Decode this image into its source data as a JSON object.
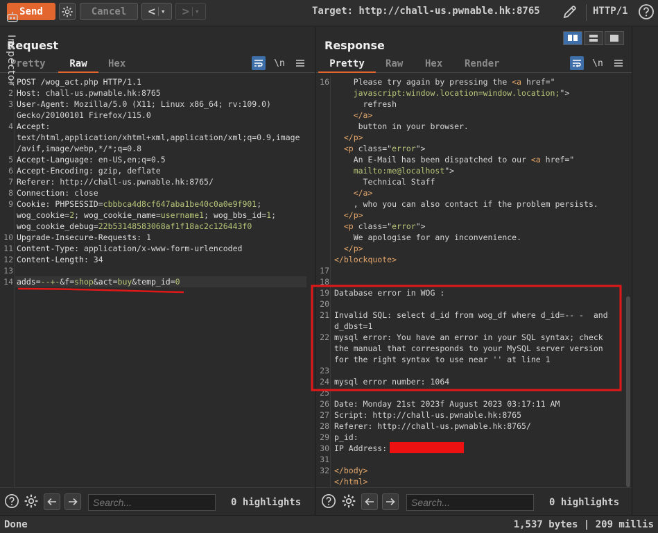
{
  "toolbar": {
    "send": "Send",
    "cancel": "Cancel",
    "target": "Target: http://chall-us.pwnable.hk:8765",
    "protocol": "HTTP/1",
    "back_arrow": "<",
    "fwd_arrow": ">",
    "dropdown": "▾"
  },
  "request": {
    "title": "Request",
    "tabs": [
      "Pretty",
      "Raw",
      "Hex"
    ],
    "active_tab": "Raw",
    "newline_toggle": "\\n",
    "lines": [
      {
        "n": "1",
        "parts": [
          [
            "k",
            "POST /wog_act.php HTTP/1.1"
          ]
        ]
      },
      {
        "n": "2",
        "parts": [
          [
            "k",
            "Host"
          ],
          [
            "p",
            ": chall-us.pwnable.hk:8765"
          ]
        ]
      },
      {
        "n": "3",
        "parts": [
          [
            "k",
            "User-Agent"
          ],
          [
            "p",
            ": Mozilla/5.0 (X11; Linux x86_64; rv:109.0)"
          ]
        ]
      },
      {
        "n": "",
        "parts": [
          [
            "p",
            "Gecko/20100101 Firefox/115.0"
          ]
        ]
      },
      {
        "n": "4",
        "parts": [
          [
            "k",
            "Accept"
          ],
          [
            "p",
            ":"
          ]
        ]
      },
      {
        "n": "",
        "parts": [
          [
            "p",
            "text/html,application/xhtml+xml,application/xml;q=0.9,image"
          ]
        ]
      },
      {
        "n": "",
        "parts": [
          [
            "p",
            "/avif,image/webp,*/*;q=0.8"
          ]
        ]
      },
      {
        "n": "5",
        "parts": [
          [
            "k",
            "Accept-Language"
          ],
          [
            "p",
            ": en-US,en;q=0.5"
          ]
        ]
      },
      {
        "n": "6",
        "parts": [
          [
            "k",
            "Accept-Encoding"
          ],
          [
            "p",
            ": gzip, deflate"
          ]
        ]
      },
      {
        "n": "7",
        "parts": [
          [
            "k",
            "Referer"
          ],
          [
            "p",
            ": http://chall-us.pwnable.hk:8765/"
          ]
        ]
      },
      {
        "n": "8",
        "parts": [
          [
            "k",
            "Connection"
          ],
          [
            "p",
            ": close"
          ]
        ]
      },
      {
        "n": "9",
        "parts": [
          [
            "k",
            "Cookie"
          ],
          [
            "p",
            ": "
          ],
          [
            "k",
            "PHPSESSID"
          ],
          [
            "p",
            "="
          ],
          [
            "v",
            "cbbbca4d8cf647aba1be40c0a0e9f901"
          ],
          [
            "p",
            ";"
          ]
        ]
      },
      {
        "n": "",
        "parts": [
          [
            "k",
            "wog_cookie"
          ],
          [
            "p",
            "="
          ],
          [
            "v",
            "2"
          ],
          [
            "p",
            "; "
          ],
          [
            "k",
            "wog_cookie_name"
          ],
          [
            "p",
            "="
          ],
          [
            "v",
            "username1"
          ],
          [
            "p",
            "; "
          ],
          [
            "k",
            "wog_bbs_id"
          ],
          [
            "p",
            "="
          ],
          [
            "v",
            "1"
          ],
          [
            "p",
            ";"
          ]
        ]
      },
      {
        "n": "",
        "parts": [
          [
            "k",
            "wog_cookie_debug"
          ],
          [
            "p",
            "="
          ],
          [
            "v",
            "22b53148583068af1f18ac2c126443f0"
          ]
        ]
      },
      {
        "n": "10",
        "parts": [
          [
            "k",
            "Upgrade-Insecure-Requests"
          ],
          [
            "p",
            ": 1"
          ]
        ]
      },
      {
        "n": "11",
        "parts": [
          [
            "k",
            "Content-Type"
          ],
          [
            "p",
            ": application/x-www-form-urlencoded"
          ]
        ]
      },
      {
        "n": "12",
        "parts": [
          [
            "k",
            "Content-Length"
          ],
          [
            "p",
            ": 34"
          ]
        ]
      },
      {
        "n": "13",
        "parts": [
          [
            "p",
            ""
          ]
        ]
      },
      {
        "n": "14",
        "parts": [
          [
            "k",
            "adds"
          ],
          [
            "p",
            "="
          ],
          [
            "v",
            "--+-"
          ],
          [
            "p",
            "&"
          ],
          [
            "k",
            "f"
          ],
          [
            "p",
            "="
          ],
          [
            "v",
            "shop"
          ],
          [
            "p",
            "&"
          ],
          [
            "k",
            "act"
          ],
          [
            "p",
            "="
          ],
          [
            "v",
            "buy"
          ],
          [
            "p",
            "&"
          ],
          [
            "k",
            "temp_id"
          ],
          [
            "p",
            "="
          ],
          [
            "v",
            "0"
          ]
        ]
      }
    ],
    "search_placeholder": "Search...",
    "highlights": "0 highlights"
  },
  "response": {
    "title": "Response",
    "tabs": [
      "Pretty",
      "Raw",
      "Hex",
      "Render"
    ],
    "active_tab": "Pretty",
    "newline_toggle": "\\n",
    "lines": [
      {
        "n": "16",
        "parts": [
          [
            "p",
            "    Please try again by pressing the "
          ],
          [
            "tag",
            "<a "
          ],
          [
            "attr",
            "href"
          ],
          [
            "p",
            "=\""
          ]
        ]
      },
      {
        "n": "",
        "parts": [
          [
            "v",
            "    javascript:window.location=window.location;"
          ],
          [
            "p",
            "\">"
          ]
        ]
      },
      {
        "n": "",
        "parts": [
          [
            "p",
            "      refresh"
          ]
        ]
      },
      {
        "n": "",
        "parts": [
          [
            "tag",
            "    </a>"
          ]
        ]
      },
      {
        "n": "",
        "parts": [
          [
            "p",
            "     button in your browser."
          ]
        ]
      },
      {
        "n": "",
        "parts": [
          [
            "tag",
            "  </p>"
          ]
        ]
      },
      {
        "n": "",
        "parts": [
          [
            "tag",
            "  <p "
          ],
          [
            "attr",
            "class"
          ],
          [
            "p",
            "=\""
          ],
          [
            "v",
            "error"
          ],
          [
            "p",
            "\">"
          ]
        ]
      },
      {
        "n": "",
        "parts": [
          [
            "p",
            "    An E-Mail has been dispatched to our "
          ],
          [
            "tag",
            "<a "
          ],
          [
            "attr",
            "href"
          ],
          [
            "p",
            "=\""
          ]
        ]
      },
      {
        "n": "",
        "parts": [
          [
            "v",
            "    mailto:me@localhost"
          ],
          [
            "p",
            "\">"
          ]
        ]
      },
      {
        "n": "",
        "parts": [
          [
            "p",
            "      Technical Staff"
          ]
        ]
      },
      {
        "n": "",
        "parts": [
          [
            "tag",
            "    </a>"
          ]
        ]
      },
      {
        "n": "",
        "parts": [
          [
            "p",
            "    , who you can also contact if the problem persists."
          ]
        ]
      },
      {
        "n": "",
        "parts": [
          [
            "tag",
            "  </p>"
          ]
        ]
      },
      {
        "n": "",
        "parts": [
          [
            "tag",
            "  <p "
          ],
          [
            "attr",
            "class"
          ],
          [
            "p",
            "=\""
          ],
          [
            "v",
            "error"
          ],
          [
            "p",
            "\">"
          ]
        ]
      },
      {
        "n": "",
        "parts": [
          [
            "p",
            "    We apologise for any inconvenience."
          ]
        ]
      },
      {
        "n": "",
        "parts": [
          [
            "tag",
            "  </p>"
          ]
        ]
      },
      {
        "n": "",
        "parts": [
          [
            "tag",
            "</blockquote>"
          ]
        ]
      },
      {
        "n": "17",
        "parts": [
          [
            "p",
            ""
          ]
        ]
      },
      {
        "n": "18",
        "parts": [
          [
            "p",
            ""
          ]
        ]
      },
      {
        "n": "19",
        "parts": [
          [
            "p",
            "Database error in WOG :"
          ]
        ]
      },
      {
        "n": "20",
        "parts": [
          [
            "p",
            ""
          ]
        ]
      },
      {
        "n": "21",
        "parts": [
          [
            "p",
            "Invalid SQL: select d_id from wog_df where d_id=-- -  and"
          ]
        ]
      },
      {
        "n": "",
        "parts": [
          [
            "p",
            "d_dbst=1"
          ]
        ]
      },
      {
        "n": "22",
        "parts": [
          [
            "p",
            "mysql error: You have an error in your SQL syntax; check"
          ]
        ]
      },
      {
        "n": "",
        "parts": [
          [
            "p",
            "the manual that corresponds to your MySQL server version"
          ]
        ]
      },
      {
        "n": "",
        "parts": [
          [
            "p",
            "for the right syntax to use near '' at line 1"
          ]
        ]
      },
      {
        "n": "23",
        "parts": [
          [
            "p",
            ""
          ]
        ]
      },
      {
        "n": "24",
        "parts": [
          [
            "p",
            "mysql error number: 1064"
          ]
        ]
      },
      {
        "n": "25",
        "parts": [
          [
            "p",
            ""
          ]
        ]
      },
      {
        "n": "26",
        "parts": [
          [
            "p",
            "Date: Monday 21st 2023f August 2023 03:17:11 AM"
          ]
        ]
      },
      {
        "n": "27",
        "parts": [
          [
            "p",
            "Script: http://chall-us.pwnable.hk:8765"
          ]
        ]
      },
      {
        "n": "28",
        "parts": [
          [
            "p",
            "Referer: http://chall-us.pwnable.hk:8765/"
          ]
        ]
      },
      {
        "n": "29",
        "parts": [
          [
            "p",
            "p_id:"
          ]
        ]
      },
      {
        "n": "30",
        "parts": [
          [
            "p",
            "IP Address:"
          ]
        ]
      },
      {
        "n": "31",
        "parts": [
          [
            "p",
            ""
          ]
        ]
      },
      {
        "n": "32",
        "parts": [
          [
            "tag",
            "</body>"
          ]
        ]
      },
      {
        "n": "",
        "parts": [
          [
            "tag",
            "</html>"
          ]
        ]
      }
    ],
    "search_placeholder": "Search...",
    "highlights": "0 highlights"
  },
  "inspector": {
    "label": "Inspector"
  },
  "status": {
    "left": "Done",
    "right": "1,537 bytes | 209 millis"
  },
  "colors": {
    "accent": "#e3662e",
    "redact": "#ee1111",
    "annotation": "#e01818"
  }
}
